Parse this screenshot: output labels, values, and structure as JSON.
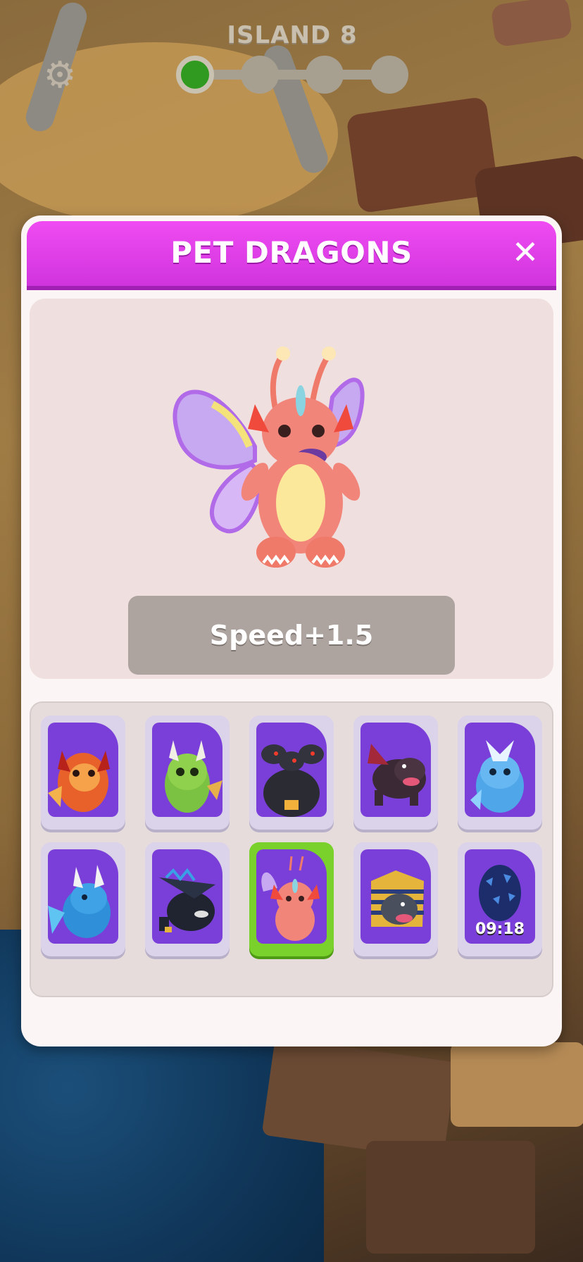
{
  "hud": {
    "island_label": "ISLAND 8",
    "settings_icon": "gear-icon",
    "progress": {
      "stages_total": 4,
      "stages_completed": 1
    }
  },
  "panel": {
    "title": "PET DRAGONS",
    "close_icon": "close-icon",
    "selected": {
      "stat": "Speed+1.5"
    },
    "dragons": [
      {
        "icon": "fire-dragon-icon",
        "color": "#e8612b",
        "selected": false
      },
      {
        "icon": "green-dragon-icon",
        "color": "#7cc242",
        "selected": false
      },
      {
        "icon": "three-headed-dragon-icon",
        "color": "#2b2b33",
        "selected": false
      },
      {
        "icon": "dark-dragon-icon",
        "color": "#3b2a35",
        "selected": false
      },
      {
        "icon": "ice-dragon-icon",
        "color": "#4fa7ea",
        "selected": false
      },
      {
        "icon": "blue-dragon-icon",
        "color": "#2f8fd8",
        "selected": false
      },
      {
        "icon": "shadow-dragon-icon",
        "color": "#1f2430",
        "selected": false
      },
      {
        "icon": "butterfly-dragon-icon",
        "color": "#f27a7a",
        "selected": true
      },
      {
        "icon": "pharaoh-dragon-icon",
        "color": "#e5b43a",
        "selected": false
      },
      {
        "icon": "dragon-egg-icon",
        "color": "#1d2d6b",
        "selected": false,
        "timer": "09:18"
      }
    ]
  },
  "colors": {
    "header": "#e040ea",
    "selected_border": "#7ad12b",
    "card_bg": "#7b3fd9"
  }
}
